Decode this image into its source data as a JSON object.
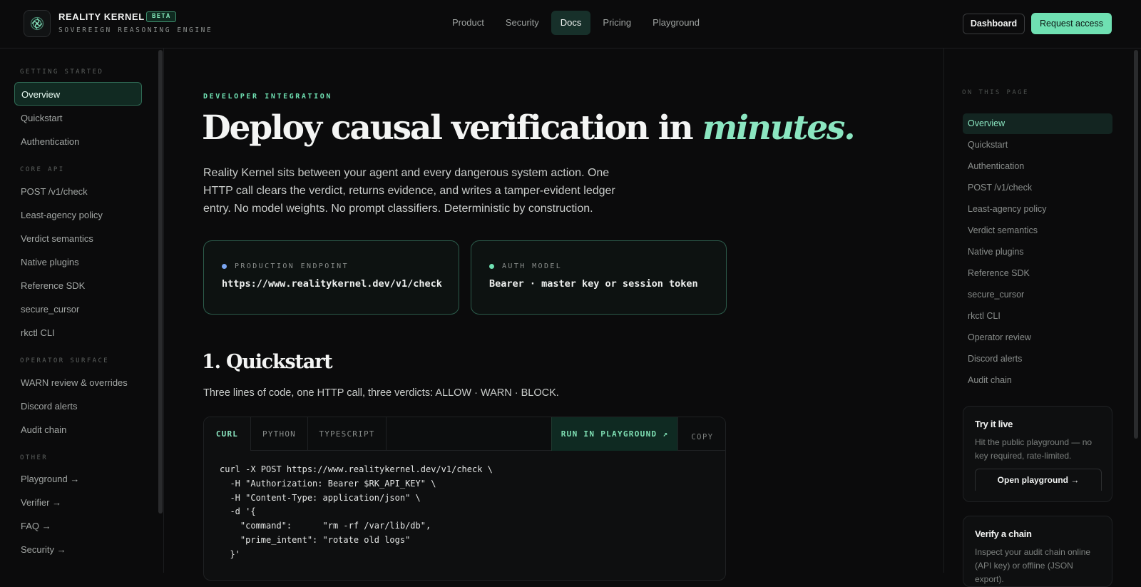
{
  "header": {
    "brand": "REALITY KERNEL",
    "badge": "BETA",
    "tagline": "SOVEREIGN REASONING ENGINE",
    "nav": [
      {
        "label": "Product"
      },
      {
        "label": "Security"
      },
      {
        "label": "Docs",
        "active": true
      },
      {
        "label": "Pricing"
      },
      {
        "label": "Playground"
      }
    ],
    "dashboard_label": "Dashboard",
    "request_label": "Request access"
  },
  "sidebar": {
    "sections": [
      {
        "heading": "GETTING STARTED",
        "items": [
          "Overview",
          "Quickstart",
          "Authentication"
        ]
      },
      {
        "heading": "CORE API",
        "items": [
          "POST /v1/check",
          "Least-agency policy",
          "Verdict semantics",
          "Native plugins",
          "Reference SDK",
          "secure_cursor",
          "rkctl CLI"
        ]
      },
      {
        "heading": "OPERATOR SURFACE",
        "items": [
          "WARN review & overrides",
          "Discord alerts",
          "Audit chain"
        ]
      },
      {
        "heading": "OTHER",
        "items": [
          "Playground →",
          "Verifier →",
          "FAQ →",
          "Security →"
        ]
      }
    ],
    "active_item": "Overview"
  },
  "main": {
    "eyebrow": "DEVELOPER INTEGRATION",
    "title_main": "Deploy causal verification in ",
    "title_accent": "minutes.",
    "lead": "Reality Kernel sits between your agent and every dangerous system action. One HTTP call clears the verdict, returns evidence, and writes a tamper-evident ledger entry. No model weights. No prompt classifiers. Deterministic by construction.",
    "cards": [
      {
        "label": "PRODUCTION ENDPOINT",
        "value": "https://www.realitykernel.dev/v1/check",
        "dot_color": "#7aa5f0"
      },
      {
        "label": "AUTH MODEL",
        "value": "Bearer · master key or session token",
        "dot_color": "#6fe0b2"
      }
    ],
    "quickstart_title": "1. Quickstart",
    "quickstart_lead": "Three lines of code, one HTTP call, three verdicts: ALLOW · WARN · BLOCK.",
    "code": {
      "tabs": [
        "CURL",
        "PYTHON",
        "TYPESCRIPT"
      ],
      "active_tab": "CURL",
      "run_label": "RUN IN PLAYGROUND ↗",
      "copy_label": "COPY",
      "lines": [
        "curl -X POST https://www.realitykernel.dev/v1/check \\",
        "  -H \"Authorization: Bearer $RK_API_KEY\" \\",
        "  -H \"Content-Type: application/json\" \\",
        "  -d '{",
        "    \"command\":      \"rm -rf /var/lib/db\",",
        "    \"prime_intent\": \"rotate old logs\"",
        "  }'"
      ]
    }
  },
  "toc": {
    "heading": "ON THIS PAGE",
    "items": [
      "Overview",
      "Quickstart",
      "Authentication",
      "POST /v1/check",
      "Least-agency policy",
      "Verdict semantics",
      "Native plugins",
      "Reference SDK",
      "secure_cursor",
      "rkctl CLI",
      "Operator review",
      "Discord alerts",
      "Audit chain"
    ],
    "active_item": "Overview",
    "try_card": {
      "title": "Try it live",
      "text": "Hit the public playground — no key required, rate-limited.",
      "button": "Open playground →"
    },
    "verify_card": {
      "title": "Verify a chain",
      "text": "Inspect your audit chain online (API key) or offline (JSON export)."
    }
  },
  "colors": {
    "accent": "#6fe0b2",
    "background": "#0b0b0c"
  }
}
